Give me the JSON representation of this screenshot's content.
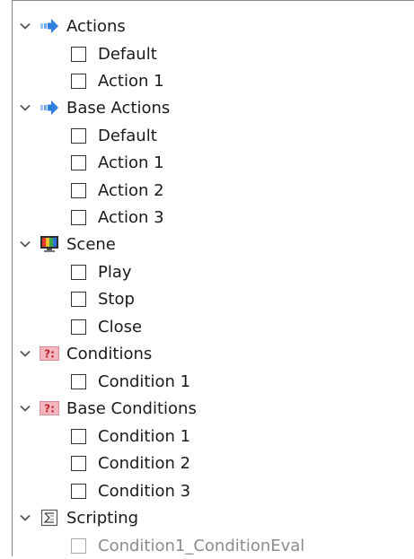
{
  "tree": {
    "groups": [
      {
        "label": "Actions",
        "icon": "blue-arrow-icon",
        "items": [
          {
            "label": "Default"
          },
          {
            "label": "Action 1"
          }
        ]
      },
      {
        "label": "Base Actions",
        "icon": "blue-arrow-icon",
        "items": [
          {
            "label": "Default"
          },
          {
            "label": "Action 1"
          },
          {
            "label": "Action 2"
          },
          {
            "label": "Action 3"
          }
        ]
      },
      {
        "label": "Scene",
        "icon": "monitor-icon",
        "items": [
          {
            "label": "Play"
          },
          {
            "label": "Stop"
          },
          {
            "label": "Close"
          }
        ]
      },
      {
        "label": "Conditions",
        "icon": "condition-icon",
        "icon_text": "?:",
        "items": [
          {
            "label": "Condition 1"
          }
        ]
      },
      {
        "label": "Base Conditions",
        "icon": "condition-icon",
        "icon_text": "?:",
        "items": [
          {
            "label": "Condition 1"
          },
          {
            "label": "Condition 2"
          },
          {
            "label": "Condition 3"
          }
        ]
      },
      {
        "label": "Scripting",
        "icon": "script-icon",
        "items": [
          {
            "label": "Condition1_ConditionEval",
            "disabled": true
          }
        ]
      }
    ]
  },
  "colors": {
    "arrow_blue": "#2f7fe0",
    "condition_bg": "#f3b6bf",
    "condition_text": "#c0202e",
    "disabled_text": "#8c8c8c"
  }
}
